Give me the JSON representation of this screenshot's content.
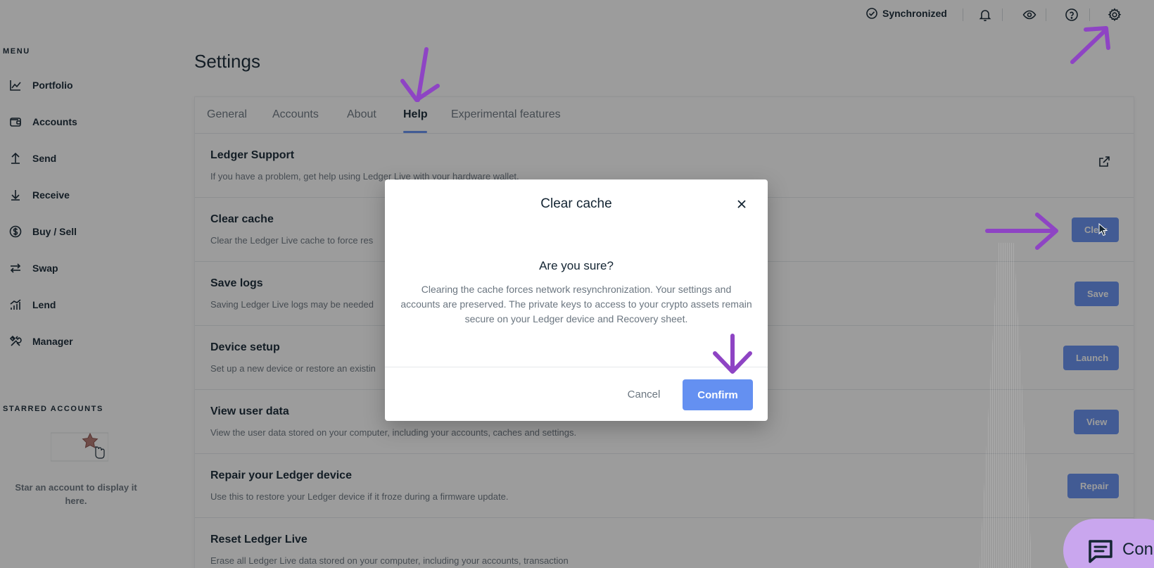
{
  "sidebar": {
    "menu_title": "MENU",
    "items": [
      {
        "label": "Portfolio",
        "icon": "chart-line-icon"
      },
      {
        "label": "Accounts",
        "icon": "wallet-icon"
      },
      {
        "label": "Send",
        "icon": "arrow-up-icon"
      },
      {
        "label": "Receive",
        "icon": "arrow-down-icon"
      },
      {
        "label": "Buy / Sell",
        "icon": "dollar-circle-icon"
      },
      {
        "label": "Swap",
        "icon": "swap-icon"
      },
      {
        "label": "Lend",
        "icon": "lend-bars-icon"
      },
      {
        "label": "Manager",
        "icon": "tools-icon"
      }
    ],
    "starred_title": "STARRED ACCOUNTS",
    "starred_empty_text": "Star an account to display it here."
  },
  "topbar": {
    "sync_label": "Synchronized",
    "icons": [
      "check-circle-icon",
      "bell-icon",
      "eye-icon",
      "help-circle-icon",
      "gear-icon"
    ]
  },
  "page": {
    "title": "Settings",
    "tabs": [
      {
        "label": "General",
        "active": false
      },
      {
        "label": "Accounts",
        "active": false
      },
      {
        "label": "About",
        "active": false
      },
      {
        "label": "Help",
        "active": true
      },
      {
        "label": "Experimental features",
        "active": false
      }
    ],
    "rows": [
      {
        "title": "Ledger Support",
        "desc": "If you have a problem, get help using Ledger Live with your hardware wallet.",
        "action": "external-link-icon"
      },
      {
        "title": "Clear cache",
        "desc": "Clear the Ledger Live cache to force res",
        "button": "Clear"
      },
      {
        "title": "Save logs",
        "desc": "Saving Ledger Live logs may be needed",
        "button": "Save"
      },
      {
        "title": "Device setup",
        "desc": "Set up a new device or restore an existin",
        "button": "Launch"
      },
      {
        "title": "View user data",
        "desc": "View the user data stored on your computer, including your accounts, caches and settings.",
        "button": "View"
      },
      {
        "title": "Repair your Ledger device",
        "desc": "Use this to restore your Ledger device if it froze during a firmware update.",
        "button": "Repair"
      },
      {
        "title": "Reset Ledger Live",
        "desc": "Erase all Ledger Live data stored on your computer, including your accounts, transaction"
      }
    ]
  },
  "modal": {
    "title": "Clear cache",
    "subtitle": "Are you sure?",
    "body": "Clearing the cache forces network resynchronization. Your settings and accounts are preserved. The private keys to access to your crypto assets remain secure on your Ledger device and Recovery sheet.",
    "cancel_label": "Cancel",
    "confirm_label": "Confirm"
  },
  "chat": {
    "label": "Con",
    "icon": "chat-bubble-icon"
  },
  "colors": {
    "accent": "#6490f1",
    "annotation": "#8e44c4",
    "chat_bg": "#c9a6ee",
    "text": "#142533",
    "muted": "#6b7680"
  }
}
